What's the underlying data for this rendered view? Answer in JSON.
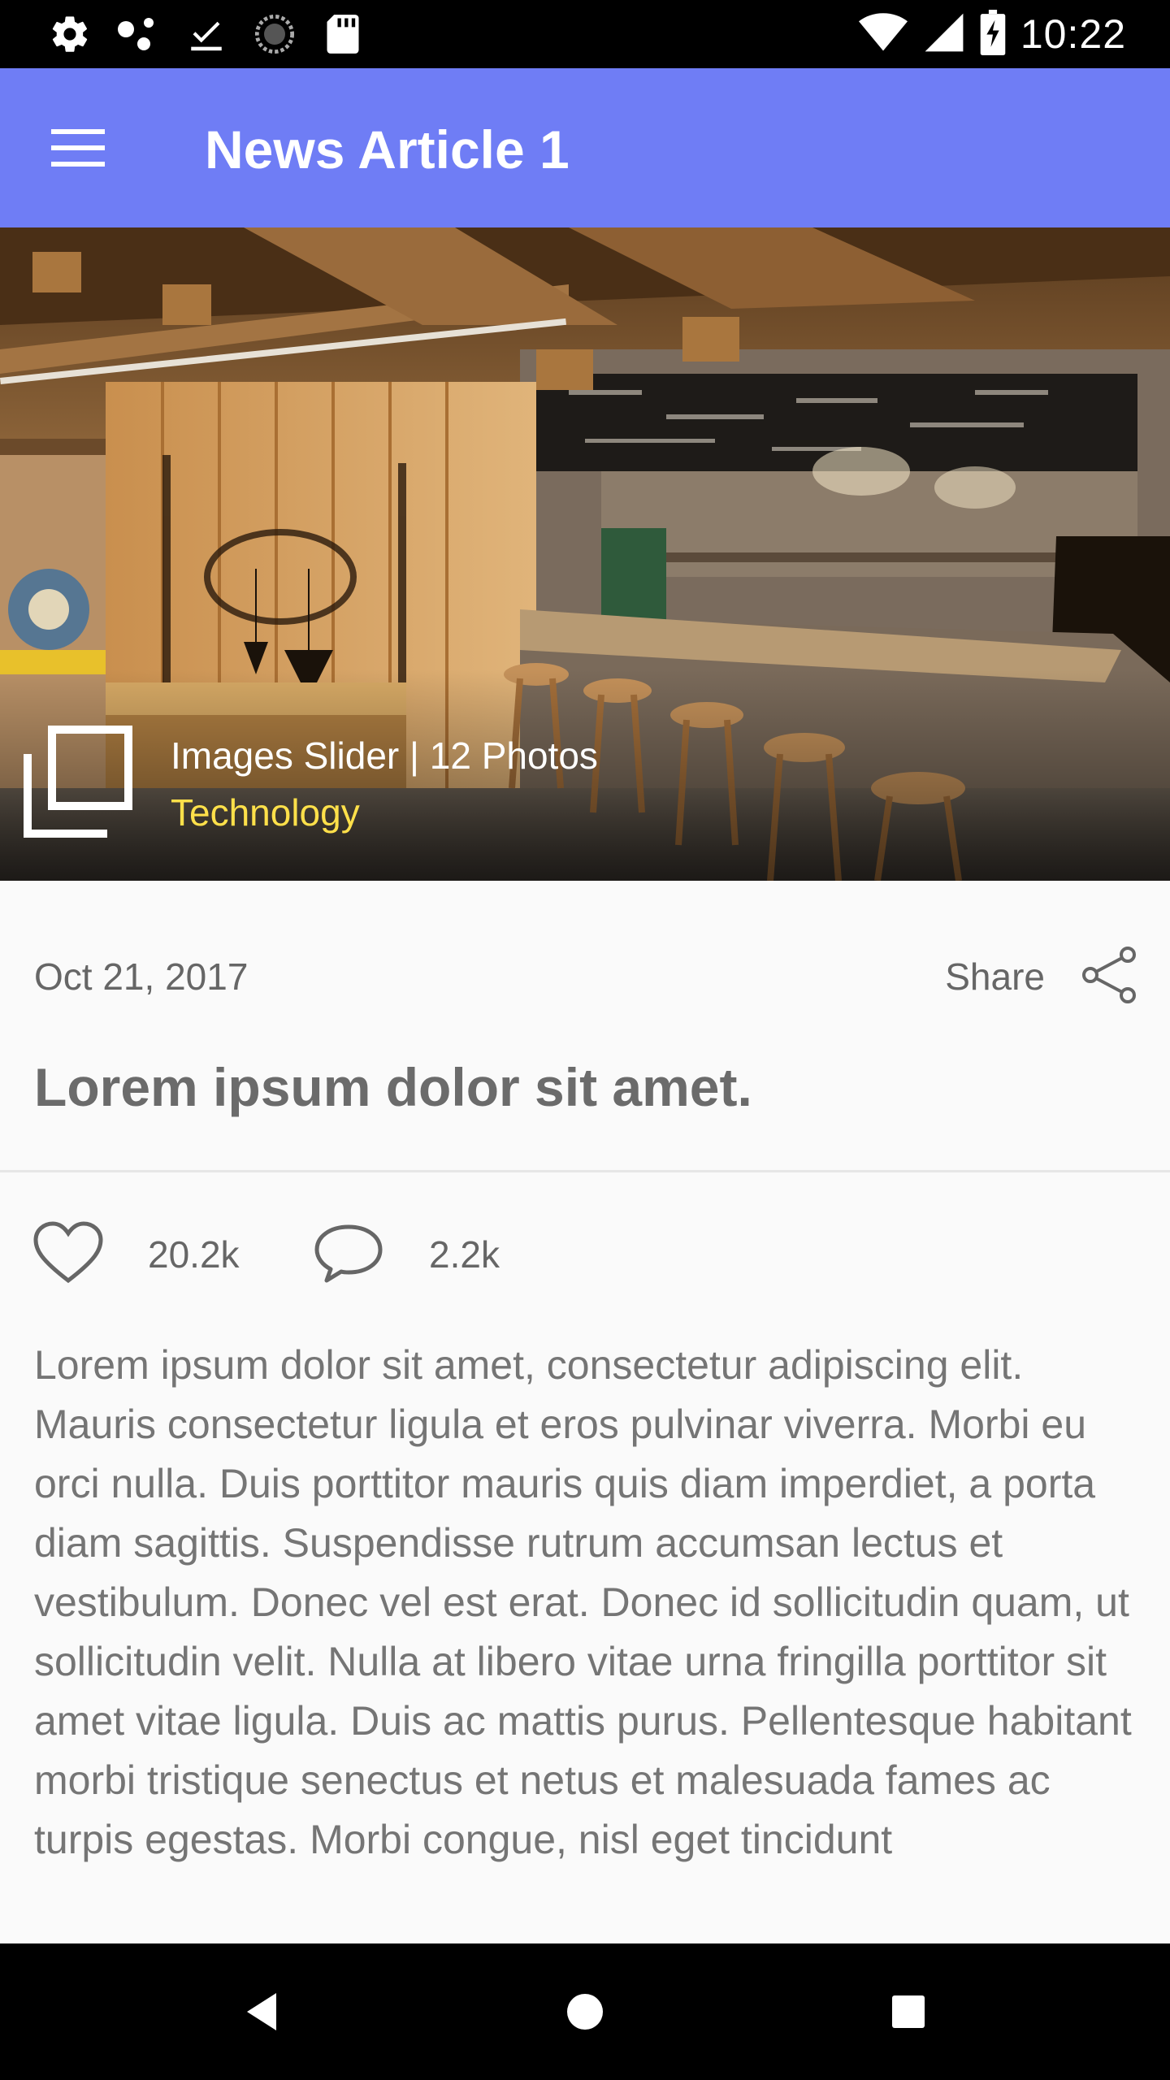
{
  "status_bar": {
    "time": "10:22",
    "icons": [
      "settings-icon",
      "share-dots-icon",
      "download-done-icon",
      "sync-icon",
      "sd-card-icon",
      "wifi-icon",
      "signal-icon",
      "battery-charging-icon"
    ]
  },
  "app_bar": {
    "title": "News Article 1",
    "menu_icon": "hamburger-menu-icon"
  },
  "hero": {
    "caption": "Images Slider | 12 Photos",
    "category": "Technology",
    "category_color": "#ffe04a",
    "gallery_icon": "gallery-icon"
  },
  "article": {
    "date": "Oct 21, 2017",
    "share_label": "Share",
    "share_icon": "share-icon",
    "headline": "Lorem ipsum dolor sit amet.",
    "likes": "20.2k",
    "comments": "2.2k",
    "body": "Lorem ipsum dolor sit amet, consectetur adipiscing elit. Mauris consectetur ligula et eros pulvinar viverra. Morbi eu orci nulla. Duis porttitor mauris quis diam imperdiet, a porta diam sagittis. Suspendisse rutrum accumsan lectus et vestibulum. Donec vel est erat. Donec id sollicitudin quam, ut sollicitudin velit. Nulla at libero vitae urna fringilla porttitor sit amet vitae ligula. Duis ac mattis purus. Pellentesque habitant morbi tristique senectus et netus et malesuada fames ac turpis egestas. Morbi congue, nisl eget tincidunt"
  },
  "nav_bar": {
    "icons": [
      "back-icon",
      "home-icon",
      "recents-icon"
    ]
  },
  "colors": {
    "app_bar": "#6f7df5",
    "status_bar": "#000000",
    "background": "#fafafa",
    "text_secondary": "#666666"
  }
}
